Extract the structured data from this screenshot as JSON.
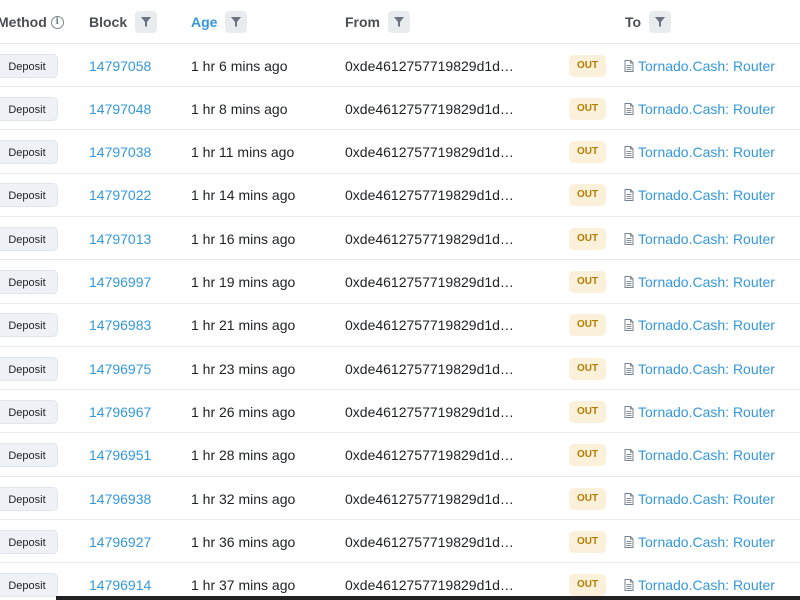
{
  "header": {
    "method": "Method",
    "block": "Block",
    "age": "Age",
    "from": "From",
    "to": "To"
  },
  "rows": [
    {
      "method": "Deposit",
      "block": "14797058",
      "age": "1 hr 6 mins ago",
      "from": "0xde4612757719829d1d…",
      "direction": "OUT",
      "to": "Tornado.Cash: Router"
    },
    {
      "method": "Deposit",
      "block": "14797048",
      "age": "1 hr 8 mins ago",
      "from": "0xde4612757719829d1d…",
      "direction": "OUT",
      "to": "Tornado.Cash: Router"
    },
    {
      "method": "Deposit",
      "block": "14797038",
      "age": "1 hr 11 mins ago",
      "from": "0xde4612757719829d1d…",
      "direction": "OUT",
      "to": "Tornado.Cash: Router"
    },
    {
      "method": "Deposit",
      "block": "14797022",
      "age": "1 hr 14 mins ago",
      "from": "0xde4612757719829d1d…",
      "direction": "OUT",
      "to": "Tornado.Cash: Router"
    },
    {
      "method": "Deposit",
      "block": "14797013",
      "age": "1 hr 16 mins ago",
      "from": "0xde4612757719829d1d…",
      "direction": "OUT",
      "to": "Tornado.Cash: Router"
    },
    {
      "method": "Deposit",
      "block": "14796997",
      "age": "1 hr 19 mins ago",
      "from": "0xde4612757719829d1d…",
      "direction": "OUT",
      "to": "Tornado.Cash: Router"
    },
    {
      "method": "Deposit",
      "block": "14796983",
      "age": "1 hr 21 mins ago",
      "from": "0xde4612757719829d1d…",
      "direction": "OUT",
      "to": "Tornado.Cash: Router"
    },
    {
      "method": "Deposit",
      "block": "14796975",
      "age": "1 hr 23 mins ago",
      "from": "0xde4612757719829d1d…",
      "direction": "OUT",
      "to": "Tornado.Cash: Router"
    },
    {
      "method": "Deposit",
      "block": "14796967",
      "age": "1 hr 26 mins ago",
      "from": "0xde4612757719829d1d…",
      "direction": "OUT",
      "to": "Tornado.Cash: Router"
    },
    {
      "method": "Deposit",
      "block": "14796951",
      "age": "1 hr 28 mins ago",
      "from": "0xde4612757719829d1d…",
      "direction": "OUT",
      "to": "Tornado.Cash: Router"
    },
    {
      "method": "Deposit",
      "block": "14796938",
      "age": "1 hr 32 mins ago",
      "from": "0xde4612757719829d1d…",
      "direction": "OUT",
      "to": "Tornado.Cash: Router"
    },
    {
      "method": "Deposit",
      "block": "14796927",
      "age": "1 hr 36 mins ago",
      "from": "0xde4612757719829d1d…",
      "direction": "OUT",
      "to": "Tornado.Cash: Router"
    },
    {
      "method": "Deposit",
      "block": "14796914",
      "age": "1 hr 37 mins ago",
      "from": "0xde4612757719829d1d…",
      "direction": "OUT",
      "to": "Tornado.Cash: Router"
    }
  ],
  "colors": {
    "link": "#3498db",
    "out_badge_bg": "#fbf0d9",
    "out_badge_text": "#b47d00",
    "method_badge_bg": "#eef2f7"
  },
  "icons": {
    "method_info": "info-circle-icon",
    "filter": "filter-icon",
    "contract": "document-icon"
  }
}
